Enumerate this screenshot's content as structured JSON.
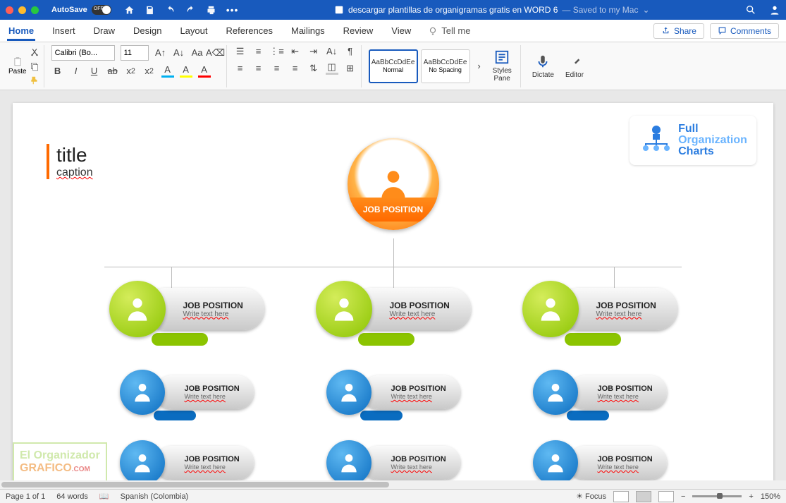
{
  "titlebar": {
    "autosave": "AutoSave",
    "autosave_state": "OFF",
    "doc_name": "descargar plantillas de organigramas gratis en WORD 6",
    "saved_status": "— Saved to my Mac"
  },
  "tabs": {
    "home": "Home",
    "insert": "Insert",
    "draw": "Draw",
    "design": "Design",
    "layout": "Layout",
    "references": "References",
    "mailings": "Mailings",
    "review": "Review",
    "view": "View",
    "tellme": "Tell me",
    "share": "Share",
    "comments": "Comments"
  },
  "ribbon": {
    "paste": "Paste",
    "font_name": "Calibri (Bo...",
    "font_size": "11",
    "bold": "B",
    "italic": "I",
    "underline": "U",
    "strike": "ab",
    "sub": "x",
    "sup": "x",
    "style_preview": "AaBbCcDdEe",
    "style1": "Normal",
    "style2": "No Spacing",
    "styles_pane": "Styles\nPane",
    "dictate": "Dictate",
    "editor": "Editor"
  },
  "doc": {
    "title": "title",
    "caption": "caption",
    "logo_l1": "Full",
    "logo_l2": "Organization",
    "logo_l3": "Charts",
    "top_position": "JOB POSITION",
    "node_title": "JOB POSITION",
    "node_sub": "Write text here",
    "wm1": "El Organizador",
    "wm2": "GRAFICO",
    "wm3": ".COM"
  },
  "status": {
    "page": "Page 1 of 1",
    "words": "64 words",
    "lang": "Spanish (Colombia)",
    "focus": "Focus",
    "zoom": "150%"
  }
}
